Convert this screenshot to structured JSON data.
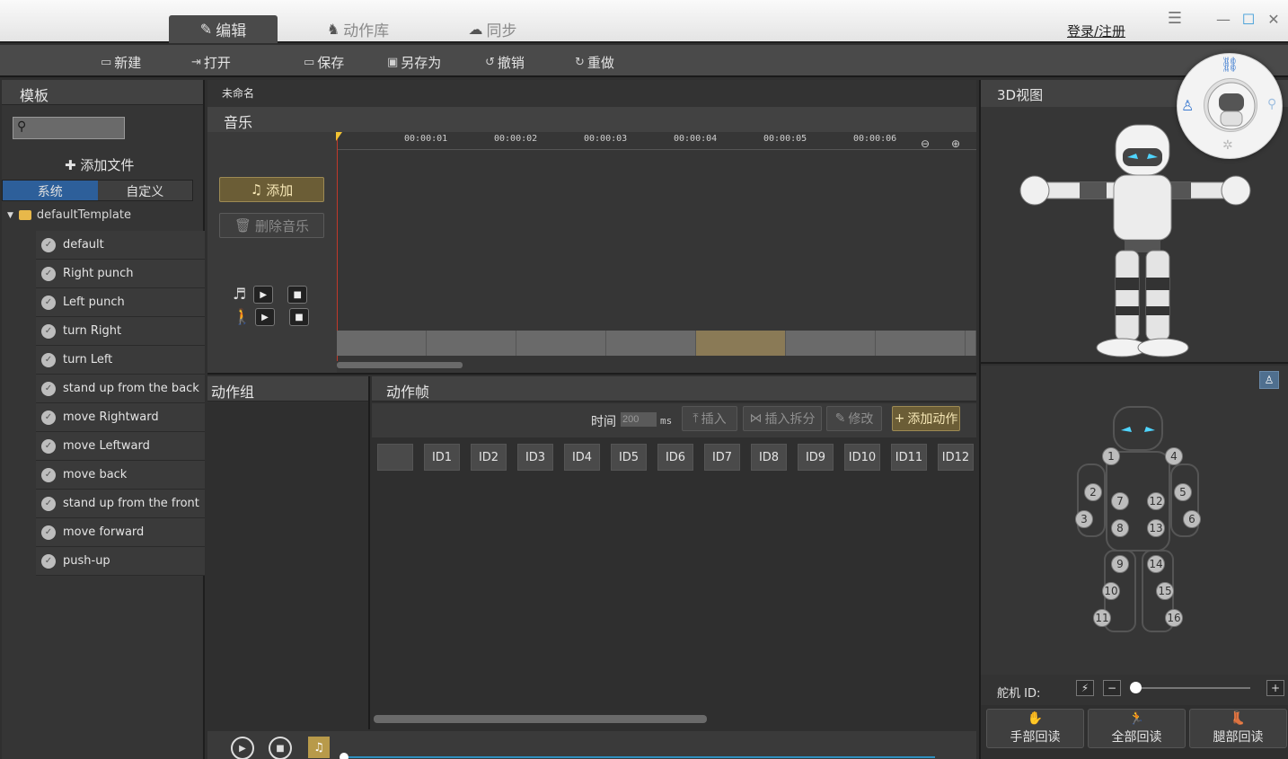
{
  "titlebar": {
    "tabs": [
      {
        "label": "编辑",
        "icon": "edit-icon"
      },
      {
        "label": "动作库",
        "icon": "robot-run-icon"
      },
      {
        "label": "同步",
        "icon": "cloud-icon"
      }
    ],
    "login": "登录/注册"
  },
  "toolbar": {
    "new_label": "新建",
    "open_label": "打开",
    "save_label": "保存",
    "save_as_label": "另存为",
    "undo_label": "撤销",
    "redo_label": "重做"
  },
  "left": {
    "title": "模板",
    "search_placeholder": "",
    "add_file_label": "添加文件",
    "subtabs": [
      "系统",
      "自定义"
    ],
    "root_folder": "defaultTemplate",
    "items": [
      "default",
      "Right punch",
      "Left punch",
      "turn Right",
      "turn Left",
      "stand up from the back",
      "move Rightward",
      "move Leftward",
      "move back",
      "stand up from the front",
      "move forward",
      "push-up"
    ]
  },
  "center": {
    "filename": "未命名",
    "music_title": "音乐",
    "add_music_label": "添加",
    "delete_music_label": "删除音乐",
    "timeline_ticks": [
      "00:00:01",
      "00:00:02",
      "00:00:03",
      "00:00:04",
      "00:00:05",
      "00:00:06"
    ]
  },
  "group": {
    "title": "动作组"
  },
  "frames": {
    "title": "动作帧",
    "time_label": "时间",
    "time_value": "200",
    "time_unit": "ms",
    "insert_label": "插入",
    "insert_split_label": "插入拆分",
    "modify_label": "修改",
    "add_action_label": "添加动作",
    "ids": [
      "ID1",
      "ID2",
      "ID3",
      "ID4",
      "ID5",
      "ID6",
      "ID7",
      "ID8",
      "ID9",
      "ID10",
      "ID11",
      "ID12"
    ]
  },
  "right": {
    "view_title": "3D视图",
    "joints": [
      "1",
      "2",
      "3",
      "4",
      "5",
      "6",
      "7",
      "8",
      "9",
      "10",
      "11",
      "12",
      "13",
      "14",
      "15",
      "16"
    ],
    "servo_label": "舵机 ID:",
    "readbacks": [
      {
        "label": "手部回读",
        "icon": "hand-icon"
      },
      {
        "label": "全部回读",
        "icon": "running-figure-icon"
      },
      {
        "label": "腿部回读",
        "icon": "boot-icon"
      }
    ]
  },
  "colors": {
    "accent_gold": "#6b5d36",
    "tab_active_blue": "#2d5f9a",
    "playhead_red": "#c0392b",
    "progress_blue": "#2f8fbf"
  }
}
